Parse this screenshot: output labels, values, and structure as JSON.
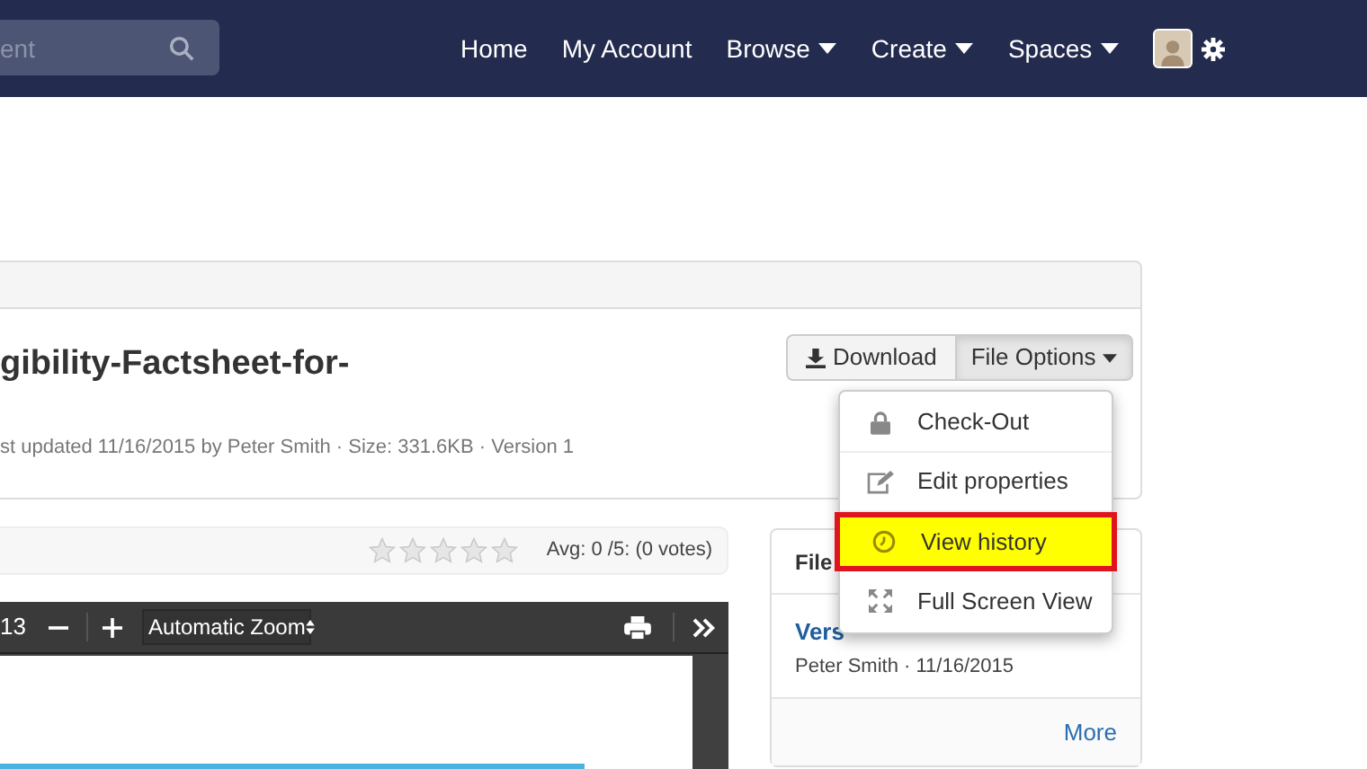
{
  "navbar": {
    "search": {
      "placeholder": "ent"
    },
    "links": [
      {
        "label": "Home",
        "dropdown": false
      },
      {
        "label": "My Account",
        "dropdown": false
      },
      {
        "label": "Browse",
        "dropdown": true
      },
      {
        "label": "Create",
        "dropdown": true
      },
      {
        "label": "Spaces",
        "dropdown": true
      }
    ]
  },
  "file": {
    "title": "gibility-Factsheet-for-",
    "meta": "st updated 11/16/2015 by Peter Smith · Size: 331.6KB · Version 1"
  },
  "buttons": {
    "download": "Download",
    "file_options": "File Options"
  },
  "file_options_menu": {
    "expanded": true,
    "items": [
      {
        "label": "Check-Out",
        "highlighted": false
      },
      {
        "label": "Edit properties",
        "highlighted": false
      },
      {
        "label": "View history",
        "highlighted": true
      },
      {
        "label": "Full Screen View",
        "highlighted": false
      }
    ]
  },
  "rating": {
    "stars": 0,
    "summary": "Avg: 0 /5: (0 votes)"
  },
  "pdf_viewer": {
    "page_count": "13",
    "zoom": "Automatic Zoom"
  },
  "side_card": {
    "header": "File",
    "version_link": "Vers",
    "author_date": "Peter Smith · 11/16/2015",
    "more": "More"
  }
}
